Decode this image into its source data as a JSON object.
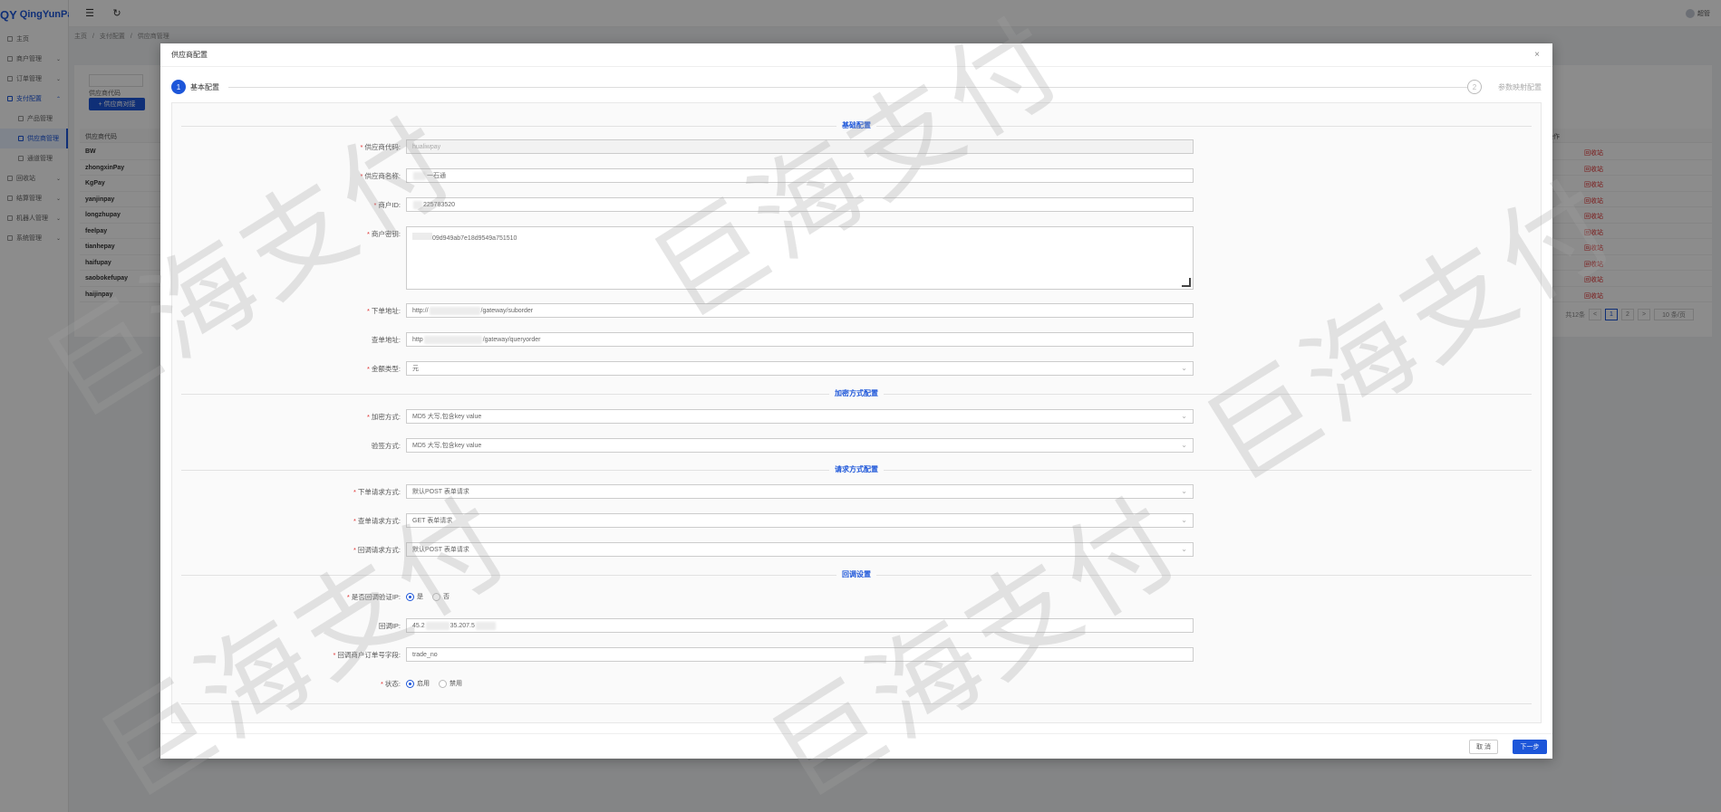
{
  "app": {
    "logo_mark": "QY",
    "logo_text": "QingYunPay",
    "user_name": "超管"
  },
  "sidebar": {
    "items": [
      {
        "label": "主页",
        "arrow": ""
      },
      {
        "label": "商户管理",
        "arrow": "⌄"
      },
      {
        "label": "订单管理",
        "arrow": "⌄"
      },
      {
        "label": "支付配置",
        "arrow": "⌃"
      },
      {
        "label": "产品管理",
        "arrow": ""
      },
      {
        "label": "供应商管理",
        "arrow": ""
      },
      {
        "label": "通道管理",
        "arrow": ""
      },
      {
        "label": "回收站",
        "arrow": "⌄"
      },
      {
        "label": "结算管理",
        "arrow": "⌄"
      },
      {
        "label": "机器人管理",
        "arrow": "⌄"
      },
      {
        "label": "系统管理",
        "arrow": "⌄"
      }
    ]
  },
  "breadcrumb": [
    "主页",
    "/",
    "支付配置",
    "/",
    "供应商管理"
  ],
  "list_page": {
    "search_label": "供应商代码",
    "add_button": "+ 供应商对接",
    "col_code": "供应商代码",
    "col_action": "操作",
    "rows": [
      "BW",
      "zhongxinPay",
      "KgPay",
      "yanjinpay",
      "longzhupay",
      "feelpay",
      "tianhepay",
      "haifupay",
      "saobokefupay",
      "haijinpay"
    ],
    "row_action": "回收站",
    "pager": {
      "total": "共12条",
      "prev": "<",
      "page1": "1",
      "page2": "2",
      "next": ">",
      "size": "10 条/页"
    }
  },
  "modal": {
    "title": "供应商配置",
    "close": "×",
    "step1_num": "1",
    "step1_label": "基本配置",
    "step2_num": "2",
    "step2_label": "参数映射配置",
    "sections": {
      "basic": "基础配置",
      "encrypt": "加密方式配置",
      "request": "请求方式配置",
      "callback": "回调设置"
    },
    "fields": {
      "code_label": "供应商代码:",
      "code_value": "hualiwpay",
      "name_label": "供应商名称:",
      "name_value": "一石通",
      "mch_label": "商户ID:",
      "mch_value": "225783520",
      "key_label": "商户密钥:",
      "key_value": "09d949ab7e18d9549a751510",
      "order_url_label": "下单地址:",
      "order_url_prefix": "http://",
      "order_url_suffix": "/gateway/suborder",
      "query_url_label": "查单地址:",
      "query_url_prefix": "http",
      "query_url_suffix": "/gateway/queryorder",
      "amount_label": "金额类型:",
      "amount_value": "元",
      "encrypt_label": "加密方式:",
      "encrypt_value": "MD5 大写,包含key value",
      "verify_label": "验签方式:",
      "verify_value": "MD5 大写,包含key value",
      "order_req_label": "下单请求方式:",
      "order_req_value": "默认POST 表单请求",
      "query_req_label": "查单请求方式:",
      "query_req_value": "GET 表单请求",
      "callback_req_label": "回调请求方式:",
      "callback_req_value": "默认POST 表单请求",
      "ip_verify_label": "是否回调验证IP:",
      "ip_verify_yes": "是",
      "ip_verify_no": "否",
      "ip_label": "回调IP:",
      "ip_prefix": "45.2",
      "ip_suffix": "35.207.5",
      "order_field_label": "回调商户订单号字段:",
      "order_field_value": "trade_no",
      "status_label": "状态:",
      "status_on": "启用",
      "status_off": "禁用"
    },
    "cancel": "取 消",
    "next": "下一步"
  },
  "watermark": "巨海支付",
  "colors": {
    "primary": "#1d56d9",
    "danger": "#e03131"
  }
}
